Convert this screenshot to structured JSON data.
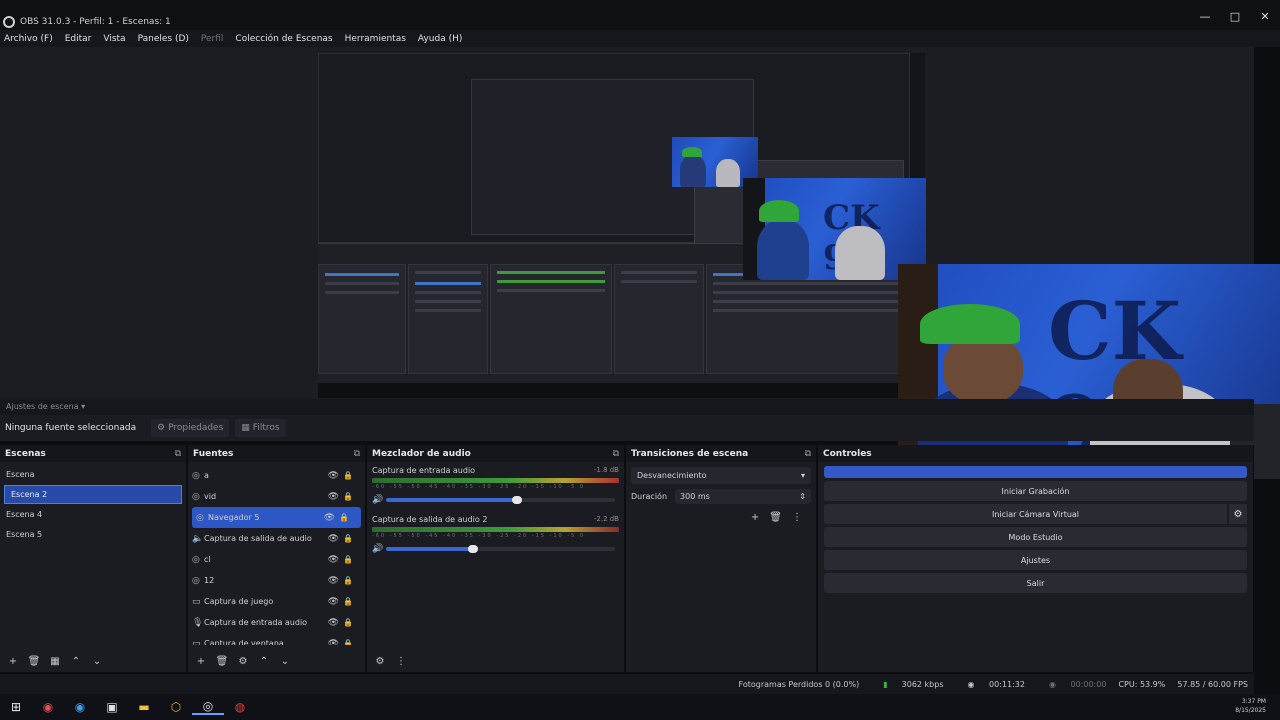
{
  "window": {
    "title": "OBS 31.0.3 - Perfil: 1 - Escenas: 1",
    "min": "—",
    "max": "□",
    "close": "✕"
  },
  "menu": [
    {
      "label": "Archivo (F)",
      "dim": false
    },
    {
      "label": "Editar",
      "dim": false
    },
    {
      "label": "Vista",
      "dim": false
    },
    {
      "label": "Paneles (D)",
      "dim": false
    },
    {
      "label": "Perfil",
      "dim": true
    },
    {
      "label": "Colección de Escenas",
      "dim": false
    },
    {
      "label": "Herramientas",
      "dim": false
    },
    {
      "label": "Ayuda (H)",
      "dim": false
    }
  ],
  "scenebar": {
    "label": "Ajustes de escena ▾"
  },
  "props": {
    "no_source": "Ninguna fuente seleccionada",
    "properties": "Propiedades",
    "filters": "Filtros"
  },
  "scenes": {
    "title": "Escenas",
    "items": [
      "Escena",
      "Escena 2",
      "Escena 4",
      "Escena 5"
    ],
    "selected_index": 1
  },
  "sources": {
    "title": "Fuentes",
    "items": [
      {
        "label": "a",
        "icon": "browser-icon"
      },
      {
        "label": "vid",
        "icon": "browser-icon"
      },
      {
        "label": "Navegador 5",
        "icon": "browser-icon"
      },
      {
        "label": "Captura de salida de audio 2",
        "icon": "speaker-icon"
      },
      {
        "label": "cl",
        "icon": "browser-icon"
      },
      {
        "label": "12",
        "icon": "browser-icon"
      },
      {
        "label": "Captura de juego",
        "icon": "gamepad-icon"
      },
      {
        "label": "Captura de entrada audio",
        "icon": "mic-icon"
      },
      {
        "label": "Captura de ventana",
        "icon": "window-icon"
      }
    ],
    "selected_index": 2
  },
  "mixer": {
    "title": "Mezclador de audio",
    "channels": [
      {
        "name": "Captura de entrada audio",
        "db": "-1.8 dB",
        "level": 0.57
      },
      {
        "name": "Captura de salida de audio 2",
        "db": "-2.2 dB",
        "level": 0.38
      }
    ],
    "scale": "-60 -55 -50 -45 -40 -35 -30 -25 -20 -15 -10 -5 0"
  },
  "transitions": {
    "title": "Transiciones de escena",
    "selected": "Desvanecimiento",
    "duration_label": "Duración",
    "duration_value": "300 ms"
  },
  "controls": {
    "title": "Controles",
    "buttons": [
      "Iniciar Grabación",
      "Iniciar Cámara Virtual",
      "Modo Estudio",
      "Ajustes",
      "Salir"
    ]
  },
  "status": {
    "frames": "Fotogramas Perdidos 0 (0.0%)",
    "bitrate": "3062 kbps",
    "stream_time": "00:11:32",
    "rec": "00:00:00",
    "cpu": "CPU: 53.9%",
    "fps": "57.85 / 60.00 FPS"
  },
  "clock": {
    "time": "3:37 PM",
    "date": "8/15/2025"
  },
  "colors": {
    "accent": "#3259c6",
    "selected": "#284ba8"
  }
}
